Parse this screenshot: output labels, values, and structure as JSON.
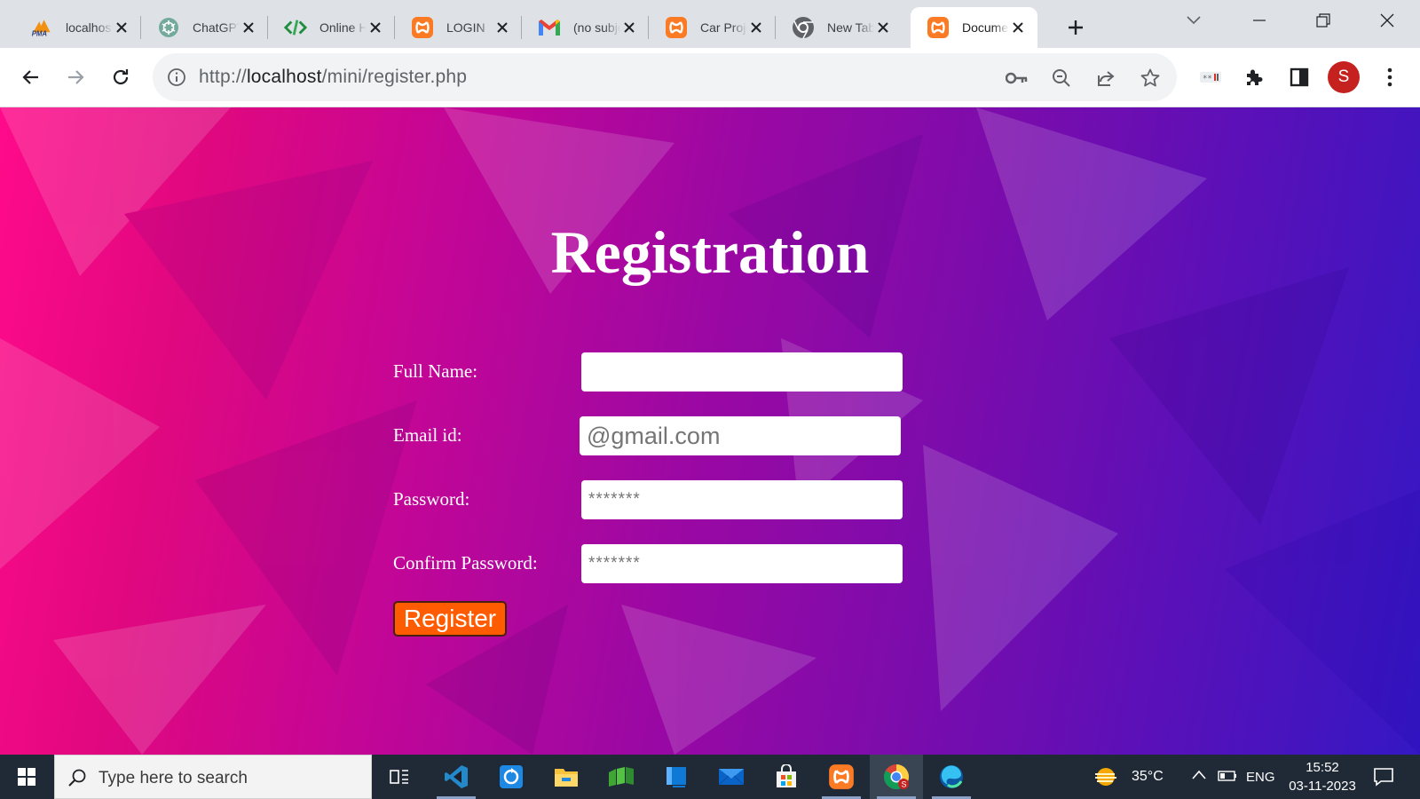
{
  "browser": {
    "tabs": [
      {
        "title": "localhost / localhost / mini",
        "icon": "phpmyadmin-icon"
      },
      {
        "title": "ChatGPT",
        "icon": "chatgpt-icon"
      },
      {
        "title": "Online HTML Editor",
        "icon": "code-editor-icon"
      },
      {
        "title": "LOGIN",
        "icon": "xampp-icon"
      },
      {
        "title": "(no subject)",
        "icon": "gmail-icon"
      },
      {
        "title": "Car Project",
        "icon": "xampp-icon"
      },
      {
        "title": "New Tab",
        "icon": "chrome-icon"
      },
      {
        "title": "Document",
        "icon": "xampp-icon",
        "active": true
      }
    ],
    "url": {
      "scheme": "http://",
      "host": "localhost",
      "path": "/mini/register.php"
    },
    "profile_initial": "S",
    "profile_color": "#c5221f"
  },
  "page": {
    "title": "Registration",
    "fields": [
      {
        "label": "Full Name:",
        "placeholder": "",
        "value": ""
      },
      {
        "label": "Email id:",
        "placeholder": "@gmail.com",
        "value": ""
      },
      {
        "label": "Password:",
        "placeholder": "*******",
        "value": ""
      },
      {
        "label": "Confirm Password:",
        "placeholder": "*******",
        "value": ""
      }
    ],
    "submit_label": "Register",
    "submit_color": "#ff5b00"
  },
  "taskbar": {
    "search_placeholder": "Type here to search",
    "apps": [
      "task-view-icon",
      "vscode-icon",
      "refresh-app-icon",
      "file-explorer-icon",
      "minecraft-icon",
      "store-sidebar-icon",
      "mail-icon",
      "microsoft-store-icon",
      "xampp-icon",
      "chrome-icon",
      "edge-icon"
    ],
    "weather": "35°C",
    "language": "ENG",
    "time": "15:52",
    "date": "03-11-2023"
  }
}
